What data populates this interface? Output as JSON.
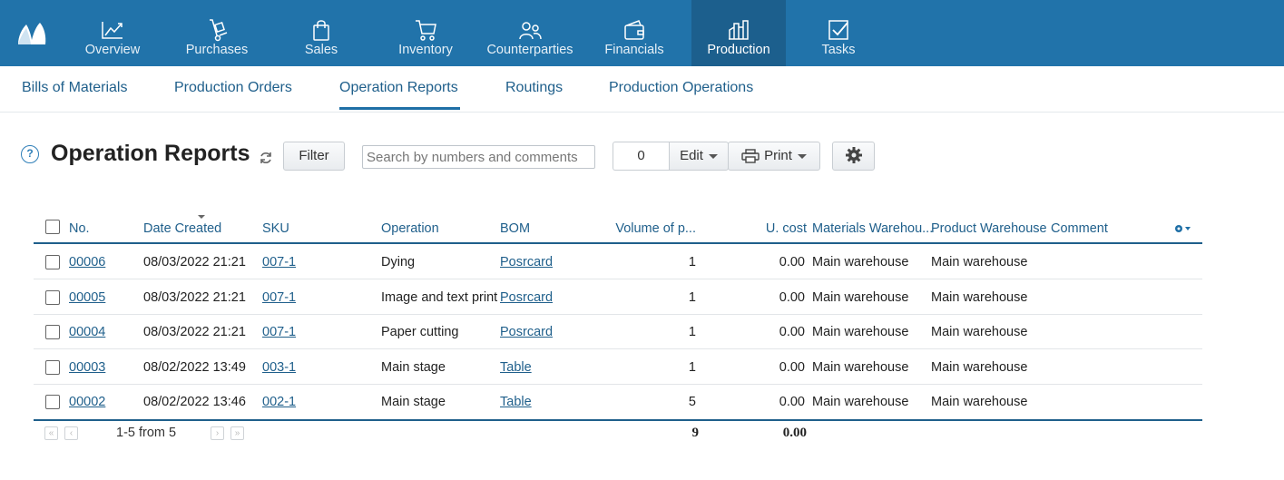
{
  "topnav": {
    "items": [
      {
        "label": "Overview",
        "icon": "chart-line-icon"
      },
      {
        "label": "Purchases",
        "icon": "hand-truck-icon"
      },
      {
        "label": "Sales",
        "icon": "shopping-bag-icon"
      },
      {
        "label": "Inventory",
        "icon": "cart-icon"
      },
      {
        "label": "Counterparties",
        "icon": "people-icon"
      },
      {
        "label": "Financials",
        "icon": "wallet-icon"
      },
      {
        "label": "Production",
        "icon": "factory-icon"
      },
      {
        "label": "Tasks",
        "icon": "checkbox-task-icon"
      }
    ],
    "active": "Production"
  },
  "subnav": {
    "tabs": [
      "Bills of Materials",
      "Production Orders",
      "Operation Reports",
      "Routings",
      "Production Operations"
    ],
    "active": "Operation Reports"
  },
  "toolbar": {
    "title": "Operation Reports",
    "filter_label": "Filter",
    "search_placeholder": "Search by numbers and comments",
    "selected_count": "0",
    "edit_label": "Edit",
    "print_label": "Print"
  },
  "table": {
    "columns": [
      "No.",
      "Date Created",
      "SKU",
      "Operation",
      "BOM",
      "Volume of p...",
      "U. cost",
      "Materials Warehou...",
      "Product Warehouse",
      "Comment"
    ],
    "rows": [
      {
        "no": "00006",
        "date": "08/03/2022 21:21",
        "sku": "007-1",
        "operation": "Dying",
        "bom": "Posrcard",
        "volume": "1",
        "cost": "0.00",
        "materials_wh": "Main warehouse",
        "product_wh": "Main warehouse",
        "comment": ""
      },
      {
        "no": "00005",
        "date": "08/03/2022 21:21",
        "sku": "007-1",
        "operation": "Image and text print",
        "bom": "Posrcard",
        "volume": "1",
        "cost": "0.00",
        "materials_wh": "Main warehouse",
        "product_wh": "Main warehouse",
        "comment": ""
      },
      {
        "no": "00004",
        "date": "08/03/2022 21:21",
        "sku": "007-1",
        "operation": "Paper cutting",
        "bom": "Posrcard",
        "volume": "1",
        "cost": "0.00",
        "materials_wh": "Main warehouse",
        "product_wh": "Main warehouse",
        "comment": ""
      },
      {
        "no": "00003",
        "date": "08/02/2022 13:49",
        "sku": "003-1",
        "operation": "Main stage",
        "bom": "Table",
        "volume": "1",
        "cost": "0.00",
        "materials_wh": "Main warehouse",
        "product_wh": "Main warehouse",
        "comment": ""
      },
      {
        "no": "00002",
        "date": "08/02/2022 13:46",
        "sku": "002-1",
        "operation": "Main stage",
        "bom": "Table",
        "volume": "5",
        "cost": "0.00",
        "materials_wh": "Main warehouse",
        "product_wh": "Main warehouse",
        "comment": ""
      }
    ],
    "pager_text": "1-5 from 5",
    "total_volume": "9",
    "total_cost": "0.00"
  }
}
